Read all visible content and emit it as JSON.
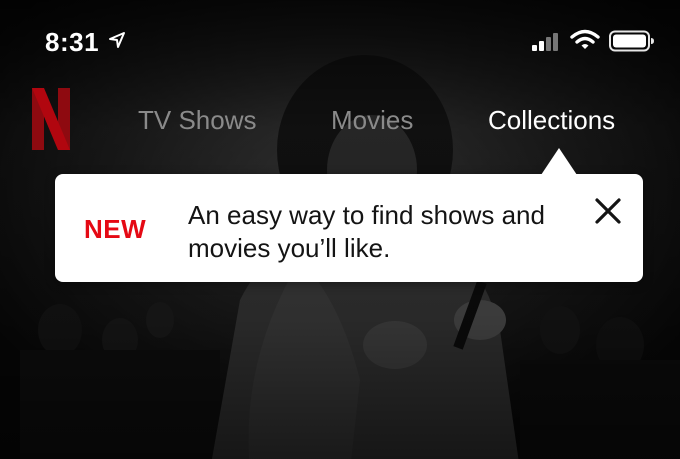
{
  "status_bar": {
    "time": "8:31",
    "icons": [
      "location-arrow-icon",
      "cellular-signal-icon",
      "wifi-icon",
      "battery-icon"
    ]
  },
  "nav": {
    "logo": "N",
    "items": [
      {
        "label": "TV Shows",
        "active": false
      },
      {
        "label": "Movies",
        "active": false
      },
      {
        "label": "Collections",
        "active": true
      }
    ]
  },
  "tooltip": {
    "badge": "NEW",
    "message": "An easy way to find shows and movies you’ll like.",
    "close_icon": "close-icon"
  },
  "colors": {
    "brand_red": "#e50914",
    "logo_red": "#b1060f",
    "inactive_nav": "#8a8a8a",
    "active_nav": "#ffffff"
  }
}
